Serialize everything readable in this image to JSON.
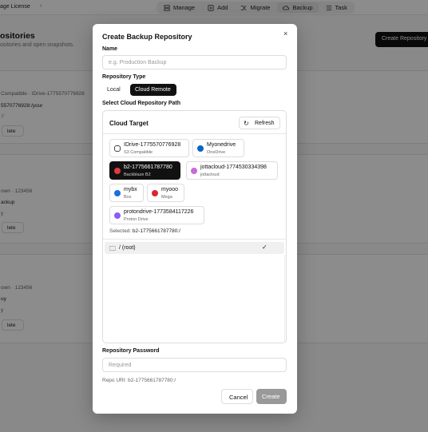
{
  "background": {
    "breadcrumb": "age License",
    "nav_tabs": [
      {
        "label": "Manage",
        "icon": "manage-icon"
      },
      {
        "label": "Add",
        "icon": "add-icon"
      },
      {
        "label": "Migrate",
        "icon": "migrate-icon"
      },
      {
        "label": "Backup",
        "icon": "backup-icon",
        "active": true
      },
      {
        "label": "Task",
        "icon": "task-icon"
      }
    ],
    "page_title": "ositories",
    "page_subtitle": "ositories and open snapshots.",
    "create_button": "Create Repository",
    "cards": [
      {
        "line1": "Compatible · IDrive-1775570776928",
        "line2": "5570776928:/your",
        "line3": ":/",
        "delete": "lete"
      },
      {
        "line1": "own · 123456",
        "line2": "ackup",
        "line3": "y",
        "delete": "lete"
      },
      {
        "line1": "own · 123456",
        "line2": "uy",
        "line3": "y",
        "delete": "lete"
      }
    ]
  },
  "modal": {
    "title": "Create Backup Repository",
    "close": "×",
    "name_label": "Name",
    "name_placeholder": "e.g. Production Backup",
    "repo_type_label": "Repository Type",
    "type_local": "Local",
    "type_cloud": "Cloud Remote",
    "cloud_path_label": "Select Cloud Repository Path",
    "cloud_target_title": "Cloud Target",
    "refresh_label": "Refresh",
    "remotes": [
      {
        "name": "IDrive-1775570776928",
        "sub": "S3 Compatible",
        "icon": "cloud-icon",
        "color": "#ffffff",
        "selected": false
      },
      {
        "name": "Myonedrive",
        "sub": "OneDrive",
        "icon": "onedrive-icon",
        "color": "#0a64c8",
        "selected": false
      },
      {
        "name": "b2-1775661787780",
        "sub": "Backblaze B2",
        "icon": "backblaze-icon",
        "color": "#e0393e",
        "selected": true
      },
      {
        "name": "jottacloud-1774530334398",
        "sub": "jottacloud",
        "icon": "jottacloud-icon",
        "color": "#c86ad8",
        "selected": false
      },
      {
        "name": "mybx",
        "sub": "Box",
        "icon": "box-icon",
        "color": "#1a6ee0",
        "selected": false
      },
      {
        "name": "myooo",
        "sub": "Mega",
        "icon": "mega-icon",
        "color": "#d9272e",
        "selected": false
      },
      {
        "name": "protondrive-1773584117226",
        "sub": "Proton Drive",
        "icon": "proton-icon",
        "color": "#8b5cf6",
        "selected": false
      }
    ],
    "selected_prefix": "Selected:",
    "selected_value": "b2-1775661787780:/",
    "path_root": "/ (root)",
    "password_label": "Repository Password",
    "password_placeholder": "Required",
    "repo_uri": "Repo URI: b2-1775661787780:/",
    "cancel": "Cancel",
    "create": "Create"
  }
}
